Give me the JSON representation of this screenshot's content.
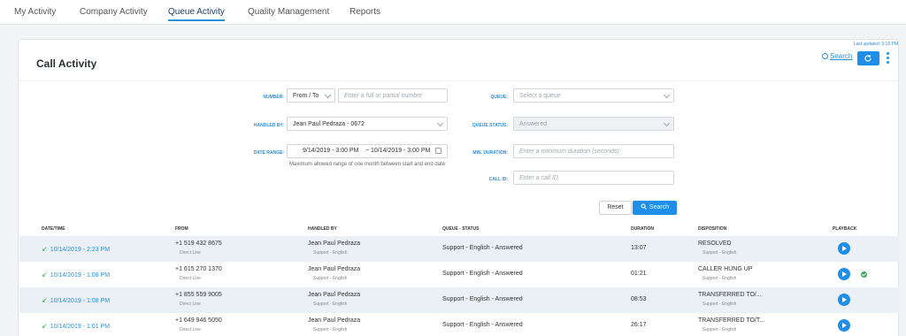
{
  "nav": {
    "tabs": [
      "My Activity",
      "Company Activity",
      "Queue Activity",
      "Quality Management",
      "Reports"
    ],
    "active": "Queue Activity"
  },
  "header": {
    "title": "Call Activity",
    "last_updated": "Last updated: 3:19 PM",
    "search_link": "Search"
  },
  "filters": {
    "number_label": "Number:",
    "number_mode": "From / To",
    "number_placeholder": "Enter a full or partial number",
    "handled_by_label": "Handled by:",
    "handled_by_value": "Jean Paul Pedraza - 0672",
    "date_range_label": "Date range:",
    "date_from": "9/14/2019 - 3:00 PM",
    "date_sep": "~",
    "date_to": "10/14/2019 - 3:00 PM",
    "date_hint": "Maximum allowed range of one month between start and end date",
    "queue_label": "Queue:",
    "queue_placeholder": "Select a queue",
    "queue_status_label": "Queue status:",
    "queue_status_value": "Answered",
    "min_duration_label": "Min. duration:",
    "min_duration_placeholder": "Enter a minimum duration (seconds)",
    "call_id_label": "Call ID:",
    "call_id_placeholder": "Enter a call ID",
    "reset_label": "Reset",
    "search_label": "Search"
  },
  "table": {
    "headers": {
      "datetime": "Date/Time",
      "from": "From",
      "handled_by": "Handled by",
      "queue_status": "Queue - Status",
      "duration": "Duration",
      "disposition": "Disposition",
      "playback": "Playback"
    },
    "rows": [
      {
        "datetime": "10/14/2019 - 2:23 PM",
        "from": "+1 519 432 8675",
        "from_sub": "Direct Line",
        "agent": "Jean Paul Pedraza",
        "agent_sub": "Support - English",
        "queue_status": "Support - English - Answered",
        "duration": "13:07",
        "disposition": "RESOLVED",
        "disposition_sub": "Support - English",
        "reviewed": false
      },
      {
        "datetime": "10/14/2019 - 1:08 PM",
        "from": "+1 615 270 1370",
        "from_sub": "Direct Line",
        "agent": "Jean Paul Pedraza",
        "agent_sub": "Support - English",
        "queue_status": "Support - English - Answered",
        "duration": "01:21",
        "disposition": "CALLER HUNG UP",
        "disposition_sub": "Support - English",
        "reviewed": true
      },
      {
        "datetime": "10/14/2019 - 1:08 PM",
        "from": "+1 855 559 9005",
        "from_sub": "Direct Line",
        "agent": "Jean Paul Pedraza",
        "agent_sub": "Support - English",
        "queue_status": "Support - English - Answered",
        "duration": "08:53",
        "disposition": "TRANSFERRED TO/...",
        "disposition_sub": "Support - English",
        "reviewed": false
      },
      {
        "datetime": "10/14/2019 - 1:01 PM",
        "from": "+1 649 946 5050",
        "from_sub": "Direct Line",
        "agent": "Jean Paul Pedraza",
        "agent_sub": "Support - English",
        "queue_status": "Support - English - Answered",
        "duration": "26:17",
        "disposition": "TRANSFERRED TO/T...",
        "disposition_sub": "Support - English",
        "reviewed": false
      }
    ]
  },
  "colors": {
    "accent": "#1e8ee8",
    "link": "#2b8fd9",
    "success": "#3aa757",
    "row_alt": "#eaf0f6"
  }
}
